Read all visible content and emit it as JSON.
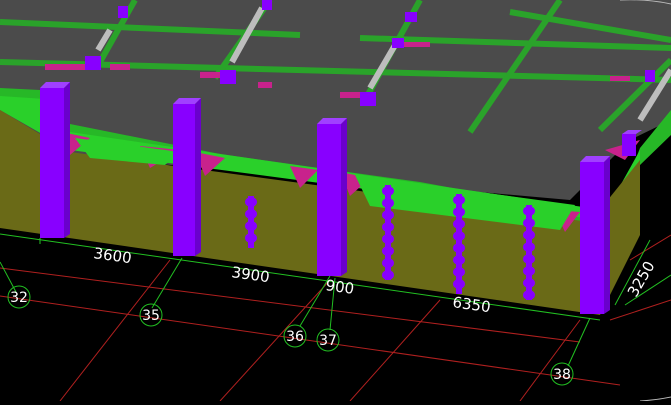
{
  "viewport": {
    "background": "#000000",
    "colors": {
      "slab": "#4d4d4d",
      "beam_green": "#2bc42b",
      "wall_olive": "#6b6a18",
      "column_purple": "#8800ff",
      "haunch_magenta": "#c8228c",
      "axis_grid_red": "#b0201f",
      "dimension_green": "#22c022",
      "label_white": "#ffffff"
    }
  },
  "dimensions": {
    "d1": "3600",
    "d2": "3900",
    "d3": "900",
    "d4": "6350",
    "d5": "3250"
  },
  "axes": {
    "a1": "32",
    "a2": "35",
    "a3": "36",
    "a4": "37",
    "a5": "38"
  }
}
